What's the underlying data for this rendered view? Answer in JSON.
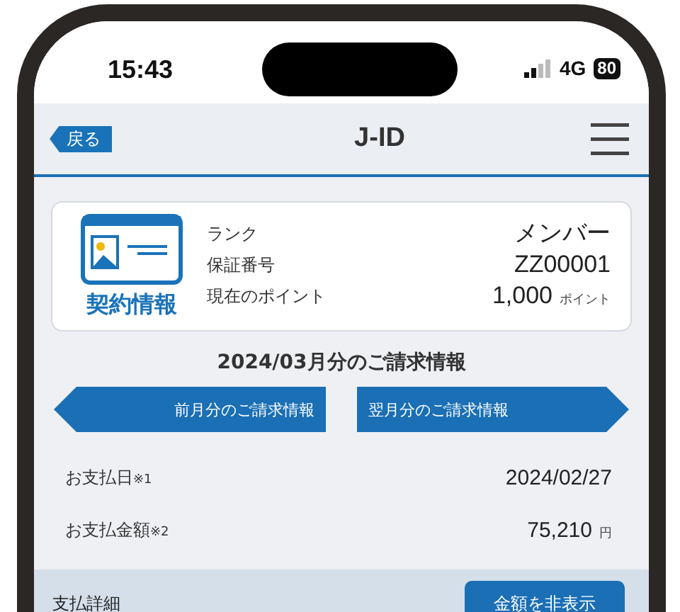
{
  "status_bar": {
    "time": "15:43",
    "network": "4G",
    "battery": "80"
  },
  "nav": {
    "back": "戻る",
    "title": "J-ID"
  },
  "contract": {
    "label": "契約情報",
    "rows": [
      {
        "label": "ランク",
        "value": "メンバー"
      },
      {
        "label": "保証番号",
        "value": "ZZ00001"
      },
      {
        "label": "現在のポイント",
        "value": "1,000",
        "unit": "ポイント"
      }
    ]
  },
  "billing": {
    "title": "2024/03月分のご請求情報",
    "prev": "前月分のご請求情報",
    "next": "翌月分のご請求情報",
    "items": [
      {
        "label": "お支払日",
        "note": "※1",
        "value": "2024/02/27"
      },
      {
        "label": "お支払金額",
        "note": "※2",
        "value": "75,210",
        "unit": "円"
      }
    ],
    "detail": {
      "label": "支払詳細",
      "button": "金額を非表示"
    }
  }
}
